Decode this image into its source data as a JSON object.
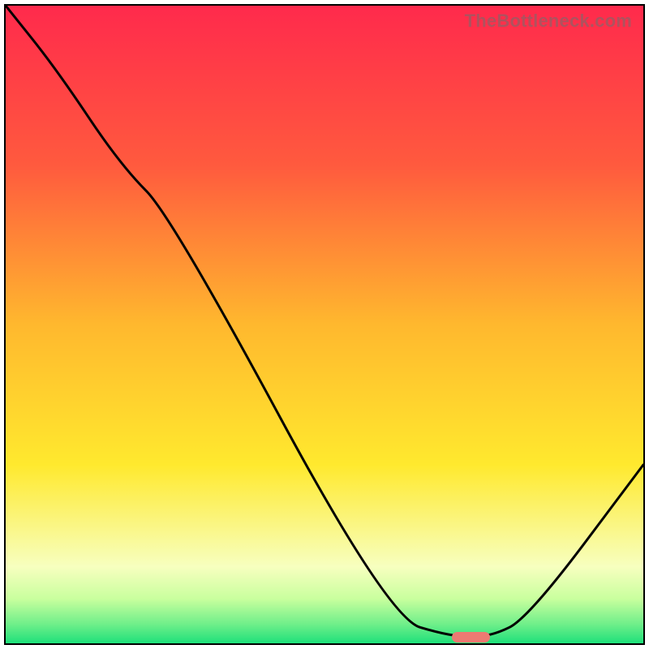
{
  "watermark": "TheBottleneck.com",
  "chart_data": {
    "type": "line",
    "title": "",
    "xlabel": "",
    "ylabel": "",
    "xlim": [
      0,
      100
    ],
    "ylim": [
      0,
      100
    ],
    "grid": false,
    "legend": false,
    "series": [
      {
        "name": "bottleneck-curve",
        "x": [
          0,
          8,
          18,
          26,
          60,
          70,
          76,
          82,
          100
        ],
        "y": [
          100,
          90,
          75,
          67,
          4,
          1,
          1,
          4,
          28
        ]
      }
    ],
    "marker": {
      "name": "optimal-range",
      "x_start": 70,
      "x_end": 76,
      "y": 1,
      "color": "#ec7a72"
    },
    "background_gradient_stops": [
      {
        "pct": 0,
        "color": "#ff2a4c"
      },
      {
        "pct": 25,
        "color": "#ff5a3e"
      },
      {
        "pct": 50,
        "color": "#ffb82e"
      },
      {
        "pct": 72,
        "color": "#ffe92e"
      },
      {
        "pct": 88,
        "color": "#f7ffbf"
      },
      {
        "pct": 93,
        "color": "#c9ff9e"
      },
      {
        "pct": 97,
        "color": "#6fef8a"
      },
      {
        "pct": 100,
        "color": "#1ee07a"
      }
    ]
  }
}
